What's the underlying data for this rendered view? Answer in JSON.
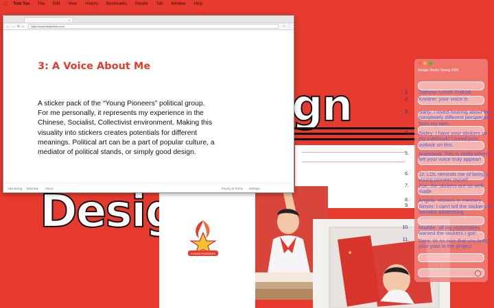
{
  "menubar": {
    "app_name": "Tom Tan",
    "items": [
      "File",
      "Edit",
      "View",
      "History",
      "Bookmarks",
      "People",
      "Tab",
      "Window",
      "Help"
    ]
  },
  "background": {
    "design_word": "Desig",
    "top_word": "gn"
  },
  "browser": {
    "url": "https://www.tbdyerism.com/",
    "title": "3: A Voice About Me",
    "body": "A sticker pack of the “Young Pioneers” political group. For me personally, it represents my experience in the Chinese, Socialist, Collectivist environment. Making this visuality into stickers creates potentials for different meanings. Political art can be a part of popular culture, a mediator of political stands, or simply good design.",
    "footer_left": [
      "Advertising",
      "Business",
      "About"
    ],
    "footer_right": [
      "Privacy & Terms",
      "Settings"
    ]
  },
  "badge_text": "YOUNG PIONEERS",
  "chat": {
    "title": "Design Studio Spring 2020",
    "messages": [
      {
        "num": "1.",
        "text": "Sammy: LOVE THESE"
      },
      {
        "num": "2.",
        "text": "Kristine: your voice is"
      },
      {
        "num": "3.",
        "text": "Jiany: I loved hearing about the completely different perspective from my own."
      },
      {
        "num": "4.",
        "text": "Sisley: I have your stickers on my notebook! I loved your outlook on this."
      },
      {
        "num": "5.",
        "text": "Anastasia: This is really where I felt your voice truly appear!"
      },
      {
        "num": "6.",
        "text": "JJ: LOL reminds me of being a young pioneer myself"
      },
      {
        "num": "7.",
        "text": "Zoe: the stickers are so well made"
      },
      {
        "num": "8.",
        "text": "Angela: stickers in memory"
      },
      {
        "num": "9.",
        "text": "Simon: I can't tell the stickers as socialist advertising"
      },
      {
        "num": "10.",
        "text": "Maddie: all my roommates wanted the stickers I got!"
      },
      {
        "num": "11.",
        "text": "Dora: its so nice that you bring your past to the project"
      }
    ],
    "send_icon": "arrow-up-icon"
  },
  "colors": {
    "background": "#e63a2e",
    "title_red": "#e63a2e",
    "chat_text": "#4a63d8"
  }
}
